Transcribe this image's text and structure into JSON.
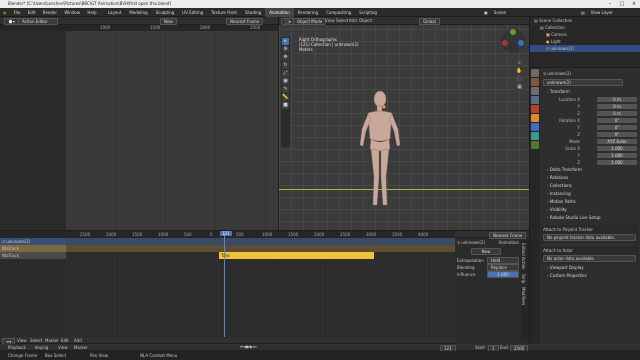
{
  "titlebar": {
    "title": "Blender* [C:\\Users\\Lenchev\\Pictures\\BBC\\GT Animation\\BVH\\first open this.blend]"
  },
  "menubar": {
    "menus": [
      "File",
      "Edit",
      "Render",
      "Window",
      "Help"
    ],
    "workspaces": [
      "Layout",
      "Modeling",
      "Sculpting",
      "UV Editing",
      "Texture Paint",
      "Shading",
      "Animation",
      "Rendering",
      "Compositing",
      "Scripting"
    ],
    "active_workspace": "Animation",
    "scene_label": "Scene",
    "view_layer_label": "View Layer"
  },
  "action_editor": {
    "mode": "Action Editor",
    "new_label": "New",
    "keyframe_label": "Nearest Frame",
    "ticks": [
      "1000",
      "1500",
      "2000",
      "2500"
    ]
  },
  "viewport": {
    "mode": "Object Mode",
    "menus": [
      "View",
      "Select",
      "Add",
      "Object"
    ],
    "orientation": "Global",
    "overlay_line1": "Right Orthographic",
    "overlay_line2": "(121) Collection | unknown(2)",
    "overlay_line3": "Meters"
  },
  "outliner": {
    "rows": [
      "Scene Collection",
      "Collection",
      "Camera",
      "Light",
      "unknown(2)"
    ]
  },
  "properties": {
    "object_name": "unknown(2)",
    "data_name": "unknown(2)",
    "transform": "Transform",
    "location_label": "Location X",
    "rows": [
      {
        "label": "Location X",
        "value": "0 m"
      },
      {
        "label": "Y",
        "value": "0 m"
      },
      {
        "label": "Z",
        "value": "0 m"
      },
      {
        "label": "Rotation X",
        "value": "0°"
      },
      {
        "label": "Y",
        "value": "0°"
      },
      {
        "label": "Z",
        "value": "0°"
      },
      {
        "label": "Mode",
        "value": "XYZ Euler"
      },
      {
        "label": "Scale X",
        "value": "1.000"
      },
      {
        "label": "Y",
        "value": "1.000"
      },
      {
        "label": "Z",
        "value": "1.000"
      }
    ],
    "sections": [
      "Delta Transform",
      "Relations",
      "Collections",
      "Instancing",
      "Motion Paths",
      "Visibility",
      "Rokoko Studio Live Setup"
    ],
    "attach_rig_label": "Attach to Pinjoint Tracker",
    "attach_rig_msg": "No pinjoint tracker data available.",
    "attach_actor_label": "Attach to Actor",
    "attach_actor_msg": "No actor data available.",
    "lower_sections": [
      "Viewport Display",
      "Custom Properties"
    ]
  },
  "nla": {
    "ticks": [
      "2500",
      "2000",
      "1500",
      "1000",
      "500",
      "0",
      "500",
      "1000",
      "1500",
      "2000",
      "2500",
      "3000",
      "3500",
      "4000"
    ],
    "current_frame": "121",
    "tracks": [
      "unknown(2)",
      "NlaTrack",
      "NlaTrack"
    ],
    "strip_label": "Take",
    "menus": [
      "View",
      "Select",
      "Marker",
      "Edit",
      "Add"
    ],
    "snap_label": "Nearest Frame"
  },
  "nla_sidebar": {
    "object": "unknown(2)",
    "animation_label": "Animation",
    "new_label": "New",
    "extrapolation_label": "Extrapolation",
    "extrapolation_value": "Hold",
    "blending_label": "Blending",
    "blending_value": "Replace",
    "influence_label": "Influence",
    "influence_value": "1.000",
    "tab_labels": [
      "Edited Action",
      "Strip",
      "Modifiers"
    ]
  },
  "status": {
    "items": [
      "Playback",
      "Keying",
      "View",
      "Marker"
    ],
    "start_label": "Start",
    "start_value": "1",
    "end_label": "End",
    "end_value": "2500",
    "frame_value": "121",
    "hints": [
      "Change Frame",
      "Box Select",
      "Pan View",
      "NLA Context Menu"
    ]
  },
  "colors": {
    "accent": "#4772b3",
    "strip": "#f0c33b",
    "track_blue": "#3b4f76",
    "track_tan": "#7a6a3d",
    "playhead": "#5b86d6"
  }
}
